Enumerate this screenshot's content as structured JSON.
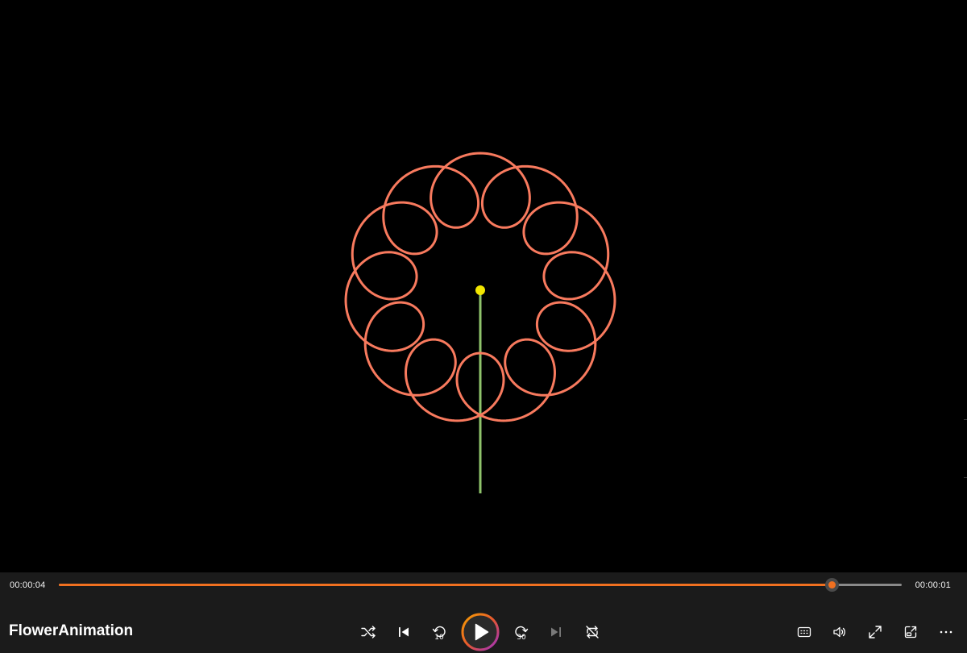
{
  "app": {
    "title": "FlowerAnimation"
  },
  "playback": {
    "elapsed": "00:00:04",
    "remaining": "00:00:01",
    "progress": 0.917
  },
  "controls": {
    "skip_back_seconds": "10",
    "skip_forward_seconds": "30",
    "icons": [
      "shuffle-icon",
      "previous-icon",
      "skip-back-10-icon",
      "play-icon",
      "skip-forward-30-icon",
      "next-icon",
      "repeat-icon",
      "subtitles-icon",
      "volume-icon",
      "fullscreen-icon",
      "mini-player-icon",
      "more-icon"
    ]
  },
  "colors": {
    "accent": "#f07020",
    "petals": "#f87a5e",
    "stem": "#8fc46b",
    "center": "#f2e600",
    "control_bar": "#1b1b1b",
    "video_bg": "#000000"
  }
}
